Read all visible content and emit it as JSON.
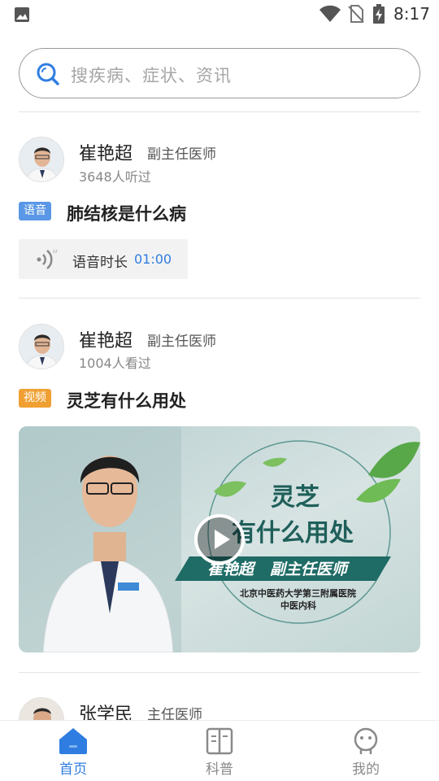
{
  "status_bar": {
    "time": "8:17"
  },
  "search": {
    "placeholder": "搜疾病、症状、资讯"
  },
  "feed": [
    {
      "doctor_name": "崔艳超",
      "doctor_title": "副主任医师",
      "count_text": "3648人听过",
      "tag": "语音",
      "title": "肺结核是什么病",
      "audio_label": "语音时长",
      "audio_duration": "01:00"
    },
    {
      "doctor_name": "崔艳超",
      "doctor_title": "副主任医师",
      "count_text": "1004人看过",
      "tag": "视频",
      "title": "灵芝有什么用处",
      "thumbnail": {
        "heading_line1": "灵芝",
        "heading_line2": "有什么用处",
        "banner": "崔艳超   副主任医师",
        "hospital": "北京中医药大学第三附属医院",
        "department": "中医内科"
      }
    },
    {
      "doctor_name": "张学民",
      "doctor_title": "主任医师"
    }
  ],
  "bottom_nav": [
    {
      "label": "首页",
      "icon": "home-icon",
      "active": true
    },
    {
      "label": "科普",
      "icon": "book-icon",
      "active": false
    },
    {
      "label": "我的",
      "icon": "profile-icon",
      "active": false
    }
  ],
  "colors": {
    "accent": "#2f7de1",
    "audio_tag": "#5a97e6",
    "video_tag": "#f0a032",
    "thumb_teal": "#1f6b66"
  }
}
